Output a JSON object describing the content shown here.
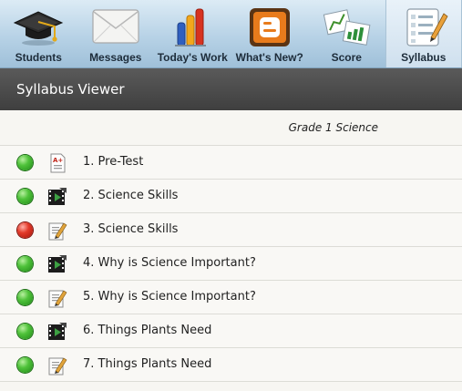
{
  "toolbar": {
    "items": [
      {
        "label": "Students",
        "icon": "graduation-cap-icon",
        "selected": false
      },
      {
        "label": "Messages",
        "icon": "envelope-icon",
        "selected": false
      },
      {
        "label": "Today's Work",
        "icon": "bar-chart-icon",
        "selected": false
      },
      {
        "label": "What's New?",
        "icon": "blogger-icon",
        "selected": false
      },
      {
        "label": "Score",
        "icon": "score-charts-icon",
        "selected": false
      },
      {
        "label": "Syllabus",
        "icon": "syllabus-checklist-icon",
        "selected": true
      }
    ]
  },
  "title": "Syllabus Viewer",
  "grade_label": "Grade 1 Science",
  "colors": {
    "complete": "#3fae2e",
    "incomplete": "#d42a1d",
    "titlebar": "#4a4a4a",
    "toolbar": "#b7d2e6"
  },
  "lessons": [
    {
      "text": "1. Pre-Test",
      "status": "complete",
      "type": "test-icon"
    },
    {
      "text": "2. Science Skills",
      "status": "complete",
      "type": "video-icon"
    },
    {
      "text": "3. Science Skills",
      "status": "incomplete",
      "type": "worksheet-icon"
    },
    {
      "text": "4. Why is Science Important?",
      "status": "complete",
      "type": "video-icon"
    },
    {
      "text": "5. Why is Science Important?",
      "status": "complete",
      "type": "worksheet-icon"
    },
    {
      "text": "6. Things Plants Need",
      "status": "complete",
      "type": "video-icon"
    },
    {
      "text": "7. Things Plants Need",
      "status": "complete",
      "type": "worksheet-icon"
    }
  ]
}
